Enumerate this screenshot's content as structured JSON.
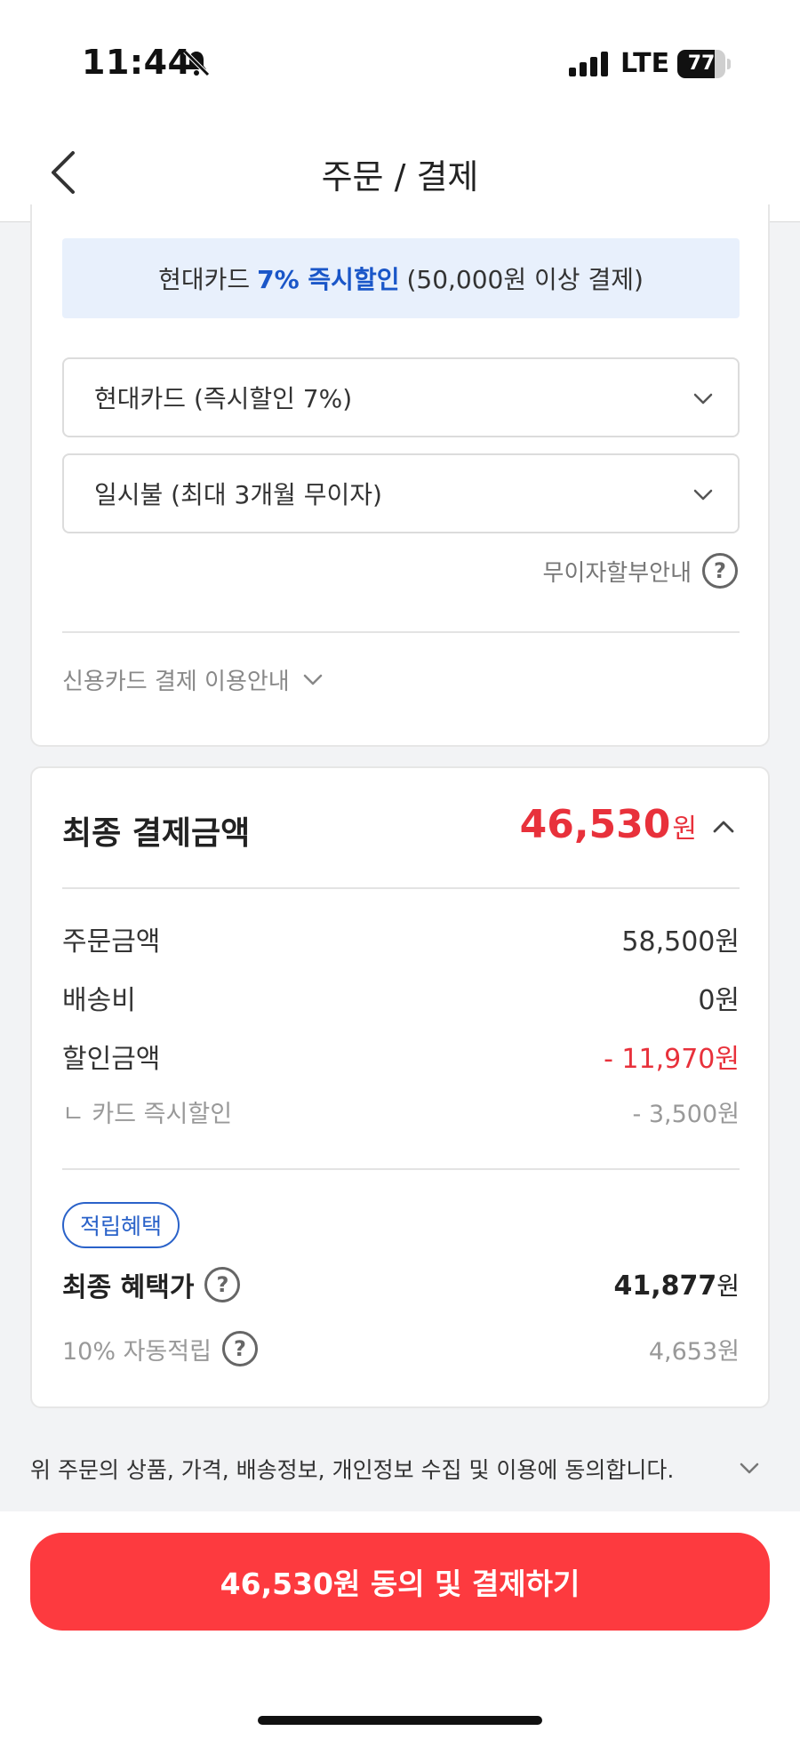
{
  "status_bar": {
    "time": "11:44",
    "network": "LTE",
    "battery": "77",
    "battery_level": 0.77
  },
  "header": {
    "title": "주문 / 결제"
  },
  "payment": {
    "promo_prefix": "현대카드",
    "promo_highlight": "7% 즉시할인",
    "promo_suffix": "(50,000원 이상 결제)",
    "card_select": "현대카드 (즉시할인 7%)",
    "installment_select": "일시불 (최대 3개월 무이자)",
    "installment_guide": "무이자할부안내",
    "credit_guide": "신용카드 결제 이용안내"
  },
  "total": {
    "title": "최종 결제금액",
    "amount": "46,530",
    "unit": "원",
    "rows": [
      {
        "label": "주문금액",
        "value": "58,500원"
      },
      {
        "label": "배송비",
        "value": "0원"
      },
      {
        "label": "할인금액",
        "value": "- 11,970원"
      },
      {
        "label": "ㄴ 카드 즉시할인",
        "value": "- 3,500원"
      }
    ],
    "badge": "적립혜택",
    "benefit_label": "최종 혜택가",
    "benefit_amount": "41,877",
    "benefit_unit": "원",
    "reward_label": "10% 자동적립",
    "reward_value": "4,653원"
  },
  "consent": {
    "text": "위 주문의 상품, 가격, 배송정보, 개인정보 수집 및 이용에 동의합니다."
  },
  "pay_button": {
    "label": "46,530원 동의 및 결제하기"
  },
  "colors": {
    "accent_red": "#fd3a3f",
    "highlight_blue": "#1a56c8",
    "banner_bg": "#e8f0fc"
  }
}
